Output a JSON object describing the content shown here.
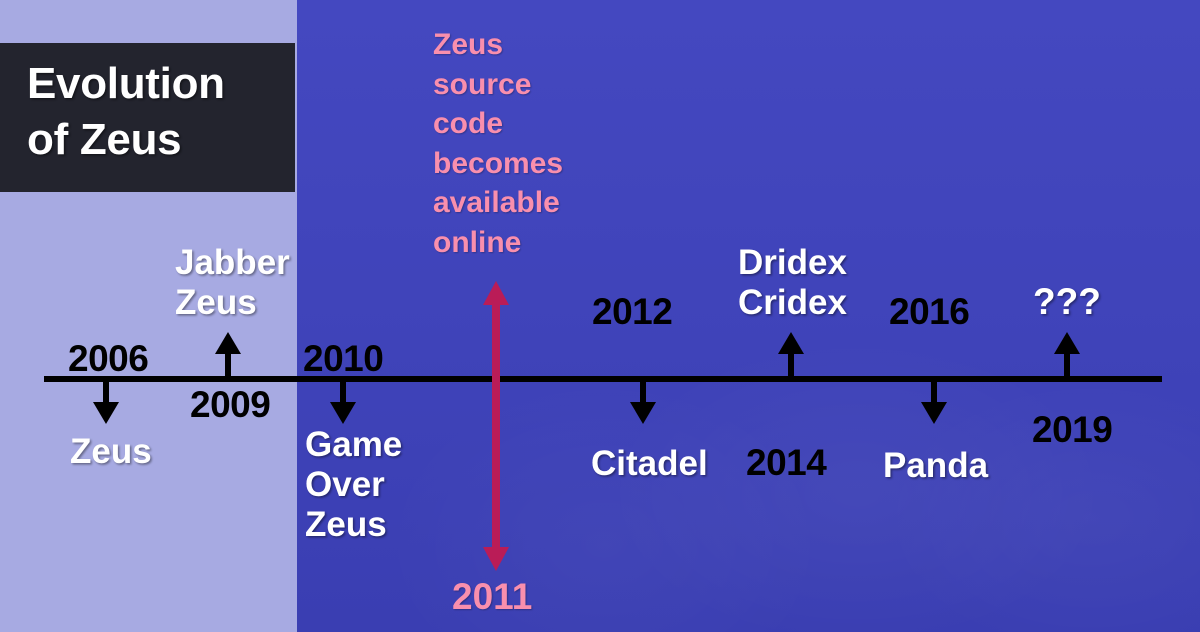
{
  "title": {
    "text": "Evolution\nof Zeus"
  },
  "colors": {
    "panel_left": "#a7aae2",
    "panel_right": "#3f43b9",
    "title_background": "#23242e",
    "title_text": "#ffffff",
    "axis": "#000000",
    "year_text": "#000000",
    "event_text": "#ffffff",
    "highlight_pink": "#f98fad",
    "highlight_arrow": "#ba1c57"
  },
  "annotation": {
    "note": "Zeus\nsource\ncode\nbecomes\navailable\nonline",
    "year": "2011"
  },
  "events": [
    {
      "year": "2006",
      "name": "Zeus",
      "direction": "down"
    },
    {
      "year": "2009",
      "name": "Jabber\nZeus",
      "direction": "up"
    },
    {
      "year": "2010",
      "name": "Game\nOver\nZeus",
      "direction": "down"
    },
    {
      "year": "2012",
      "name": "Citadel",
      "direction": "down"
    },
    {
      "year": "2014",
      "name": "Dridex\nCridex",
      "direction": "up"
    },
    {
      "year": "2016",
      "name": "Panda",
      "direction": "down"
    },
    {
      "year": "2019",
      "name": "???",
      "direction": "up"
    }
  ]
}
